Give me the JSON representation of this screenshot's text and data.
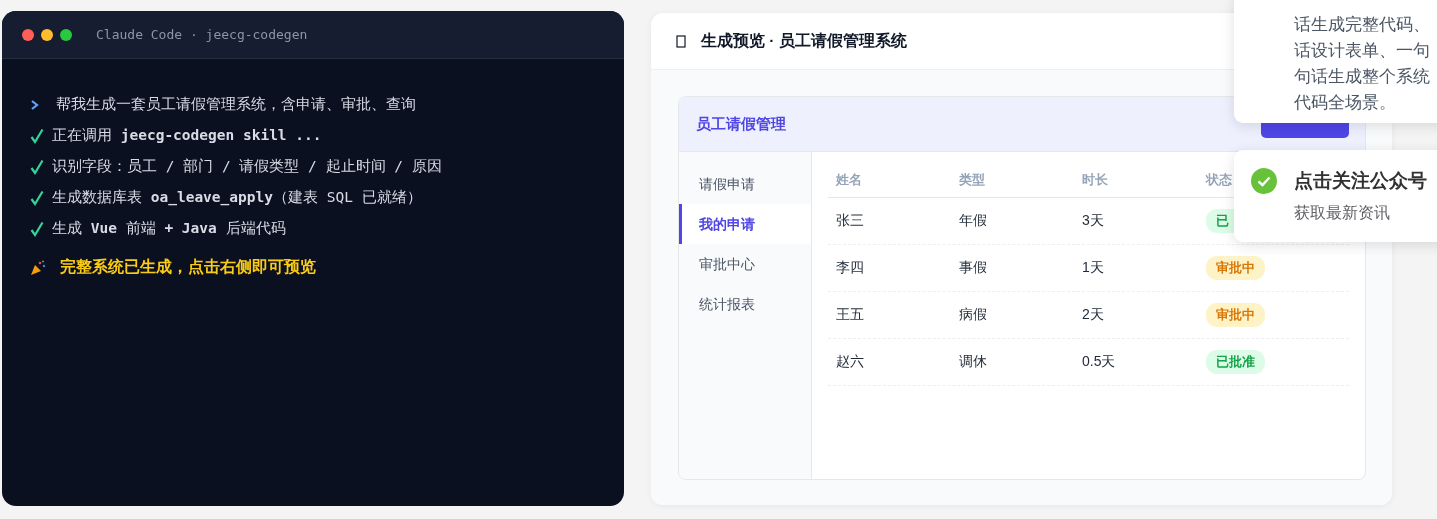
{
  "terminal": {
    "title": "Claude Code · jeecg-codegen",
    "lines": [
      {
        "kind": "prompt",
        "text": "帮我生成一套员工请假管理系统，含申请、审批、查询"
      },
      {
        "kind": "done",
        "text": "正在调用 **jeecg-codegen skill ...**"
      },
      {
        "kind": "done",
        "text": "识别字段：员工 / 部门 / 请假类型 / 起止时间 / 原因"
      },
      {
        "kind": "done",
        "text": "生成数据库表 **oa_leave_apply**（建表 SQL 已就绪）"
      },
      {
        "kind": "done",
        "text": "生成 **Vue** 前端 **+ Java** 后端代码"
      },
      {
        "kind": "result",
        "text": "完整系统已生成，点击右侧即可预览"
      }
    ]
  },
  "preview": {
    "title": "生成预览 · 员工请假管理系统",
    "panel_title": "员工请假管理",
    "sidebar": [
      {
        "label": "请假申请",
        "selected": false
      },
      {
        "label": "我的申请",
        "selected": true
      },
      {
        "label": "审批中心",
        "selected": false
      },
      {
        "label": "统计报表",
        "selected": false
      }
    ],
    "table": {
      "columns": [
        "姓名",
        "类型",
        "时长",
        "状态"
      ],
      "rows": [
        {
          "cells": [
            "张三",
            "年假",
            "3天"
          ],
          "status": "已",
          "kind": "approved"
        },
        {
          "cells": [
            "李四",
            "事假",
            "1天"
          ],
          "status": "审批中",
          "kind": "pending"
        },
        {
          "cells": [
            "王五",
            "病假",
            "2天"
          ],
          "status": "审批中",
          "kind": "pending"
        },
        {
          "cells": [
            "赵六",
            "调休",
            "0.5天"
          ],
          "status": "已批准",
          "kind": "approved"
        }
      ]
    }
  },
  "notifications": [
    {
      "kind": "text",
      "lines": [
        "话生成完整代码、",
        "话设计表单、一句",
        "句话生成整个系统",
        "代码全场景。"
      ]
    },
    {
      "kind": "success",
      "title": "点击关注公众号",
      "message": "获取最新资讯"
    }
  ]
}
